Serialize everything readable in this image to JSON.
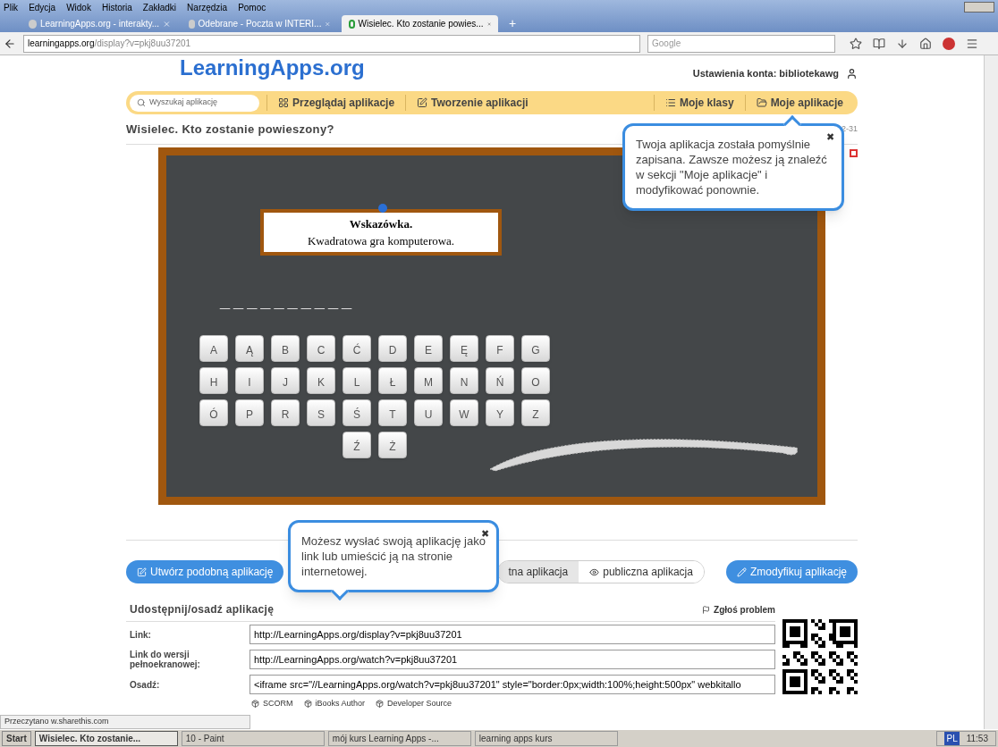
{
  "menu_bar": [
    "Plik",
    "Edycja",
    "Widok",
    "Historia",
    "Zakładki",
    "Narzędzia",
    "Pomoc"
  ],
  "tabs": [
    {
      "label": "LearningApps.org - interakty...",
      "selected": false
    },
    {
      "label": "Odebrane - Poczta w INTERI...",
      "selected": false
    },
    {
      "label": "Wisielec. Kto zostanie powies...",
      "selected": true
    }
  ],
  "new_tab": "+",
  "address_bar": {
    "host": "learningapps.org",
    "path": "/display?v=pkj8uu37201"
  },
  "search_bar": {
    "placeholder": "Google"
  },
  "site": {
    "logo": "LearningApps.org",
    "account": "Ustawienia konta: bibliotekawg",
    "nav": {
      "search_placeholder": "Wyszukaj aplikację",
      "items": [
        {
          "label": "Przeglądaj aplikacje",
          "kind": "grid"
        },
        {
          "label": "Tworzenie aplikacji",
          "kind": "edit"
        },
        {
          "label": "Moje klasy",
          "kind": "list"
        },
        {
          "label": "Moje aplikacje",
          "kind": "folder"
        }
      ]
    },
    "app_title": "Wisielec. Kto zostanie powieszony?",
    "app_meta": "2-31"
  },
  "game": {
    "hint_title": "Wskazówka.",
    "hint_text": "Kwadratowa gra komputerowa.",
    "word_mask": "__________",
    "keys": [
      [
        "A",
        "Ą",
        "B",
        "C",
        "Ć",
        "D",
        "E",
        "Ę",
        "F",
        "G"
      ],
      [
        "H",
        "I",
        "J",
        "K",
        "L",
        "Ł",
        "M",
        "N",
        "Ń",
        "O"
      ],
      [
        "Ó",
        "P",
        "R",
        "S",
        "Ś",
        "T",
        "U",
        "W",
        "Y",
        "Z"
      ],
      [
        "Ź",
        "Ż"
      ]
    ]
  },
  "tooltips": [
    {
      "text": "Twoja aplikacja została pomyślnie zapisana. Zawsze możesz ją znaleźć w sekcji \"Moje aplikacje\" i modyfikować ponownie.",
      "close": "✖"
    },
    {
      "text": "Możesz wysłać swoją aplikację jako link lub umieścić ją na stronie internetowej.",
      "close": "✖"
    }
  ],
  "actions": {
    "create_similar": "Utwórz podobną aplikację",
    "visibility": [
      {
        "label": "tna aplikacja",
        "selected": true
      },
      {
        "label": "publiczna aplikacja",
        "selected": false
      }
    ],
    "modify": "Zmodyfikuj aplikację"
  },
  "share": {
    "title": "Udostępnij/osadź aplikację",
    "report": "Zgłoś problem",
    "rows": [
      {
        "label": "Link:",
        "value": "http://LearningApps.org/display?v=pkj8uu37201"
      },
      {
        "label": "Link do wersji pełnoekranowej:",
        "value": "http://LearningApps.org/watch?v=pkj8uu37201"
      },
      {
        "label": "Osadź:",
        "value": "<iframe src=\"//LearningApps.org/watch?v=pkj8uu37201\" style=\"border:0px;width:100%;height:500px\" webkitallo"
      }
    ],
    "exports": [
      "SCORM",
      "iBooks Author",
      "Developer Source"
    ]
  },
  "status_bar": "Przeczytano w.sharethis.com",
  "taskbar": {
    "start": "Start",
    "items": [
      {
        "label": "Wisielec. Kto zostanie...",
        "selected": true
      },
      {
        "label": "10 - Paint",
        "selected": false
      },
      {
        "label": "mój kurs Learning Apps -...",
        "selected": false
      },
      {
        "label": "learning apps kurs",
        "selected": false
      }
    ],
    "language": "PL",
    "clock": "11:53"
  }
}
